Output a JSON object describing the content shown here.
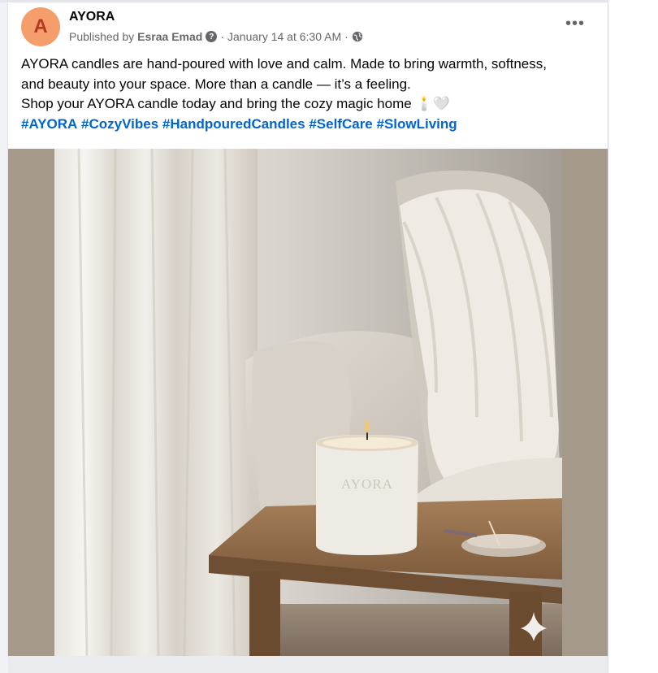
{
  "post": {
    "page_name": "AYORA",
    "avatar_letter": "A",
    "published_by_prefix": "Published by",
    "author": "Esraa Emad",
    "date": "January 14 at 6:30 AM",
    "more_label": "•••",
    "text_lines": [
      "AYORA candles are hand-poured with love and calm. Made to bring warmth, softness,",
      "and beauty into your space. More than a candle — it’s a feeling.",
      "Shop your AYORA candle today and bring the cozy magic home"
    ],
    "emojis": "🕯️🤍",
    "hashtags": [
      "#AYORA",
      "#CozyVibes",
      "#HandpouredCandles",
      "#SelfCare",
      "#SlowLiving"
    ]
  },
  "image": {
    "candle_brand": "AYORA"
  },
  "colors": {
    "accent_link": "#0064d1",
    "avatar_bg": "#f59e6b",
    "media_bg": "#a5998b"
  }
}
